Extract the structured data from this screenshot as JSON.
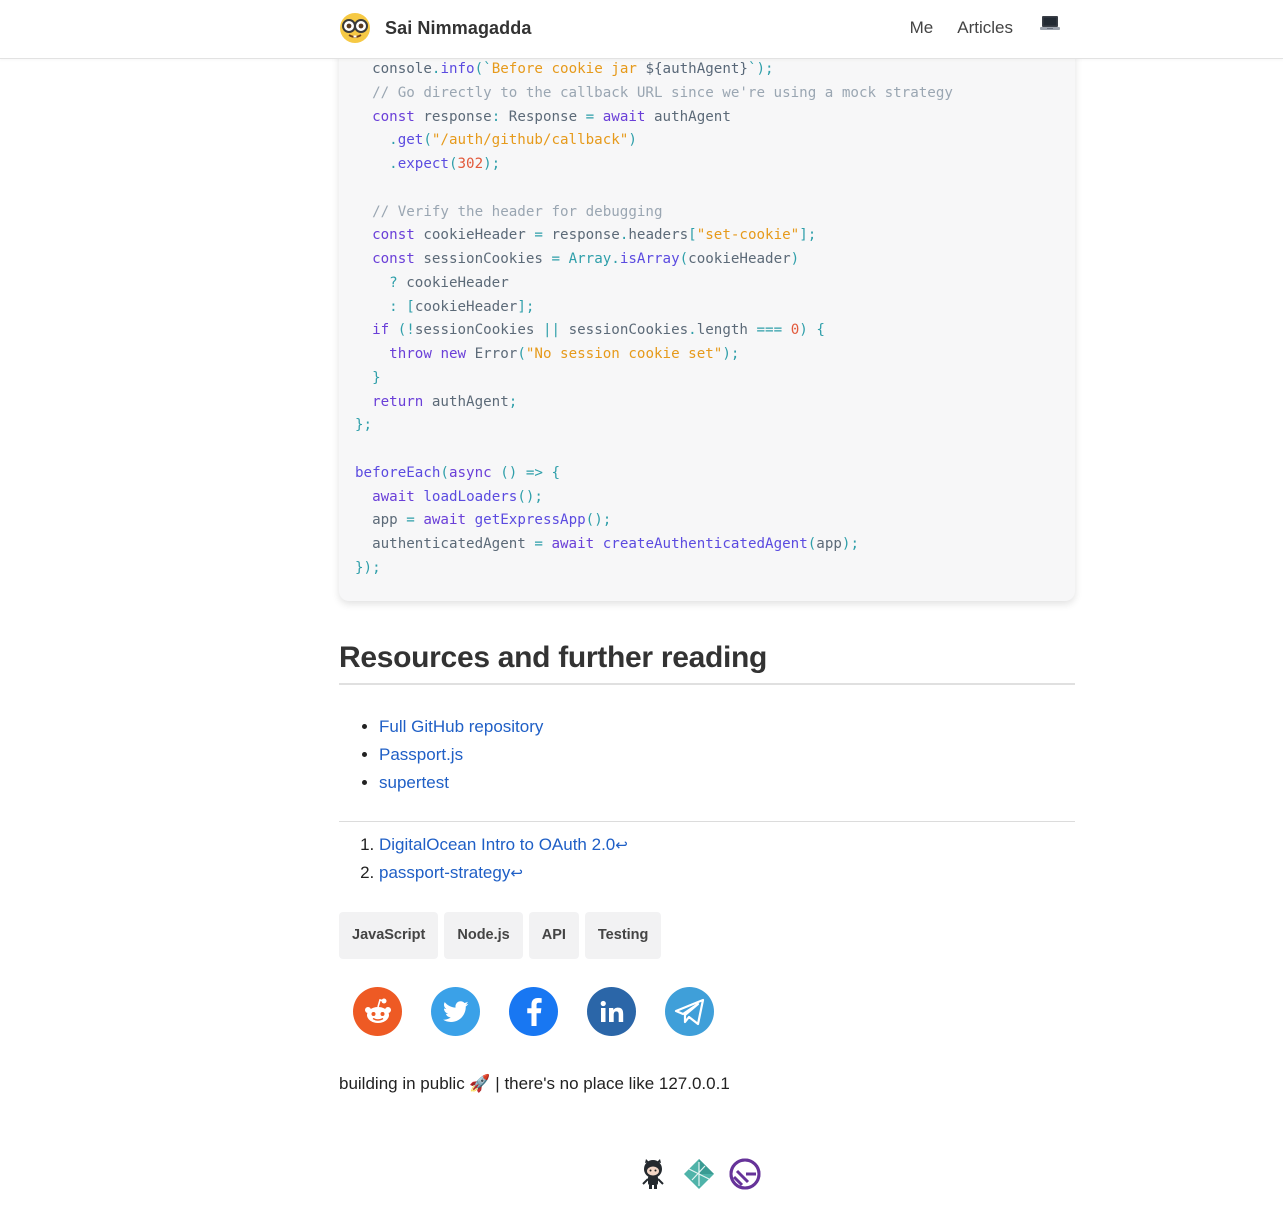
{
  "header": {
    "site_name": "Sai Nimmagadda",
    "nav": [
      {
        "label": "Me"
      },
      {
        "label": "Articles"
      }
    ],
    "avatar_icon": "nerd-face-emoji",
    "theme_icon": "laptop-icon"
  },
  "code": {
    "language": "typescript",
    "lines": [
      "  console.info(`Before cookie jar ${authAgent}`);",
      "  // Go directly to the callback URL since we're using a mock strategy",
      "  const response: Response = await authAgent",
      "    .get(\"/auth/github/callback\")",
      "    .expect(302);",
      "",
      "  // Verify the header for debugging",
      "  const cookieHeader = response.headers[\"set-cookie\"];",
      "  const sessionCookies = Array.isArray(cookieHeader)",
      "    ? cookieHeader",
      "    : [cookieHeader];",
      "  if (!sessionCookies || sessionCookies.length === 0) {",
      "    throw new Error(\"No session cookie set\");",
      "  }",
      "  return authAgent;",
      "};",
      "",
      "beforeEach(async () => {",
      "  await loadLoaders();",
      "  app = await getExpressApp();",
      "  authenticatedAgent = await createAuthenticatedAgent(app);",
      "});"
    ]
  },
  "resources": {
    "heading": "Resources and further reading",
    "links": [
      {
        "label": "Full GitHub repository"
      },
      {
        "label": "Passport.js"
      },
      {
        "label": "supertest"
      }
    ]
  },
  "footnotes": [
    {
      "label": "DigitalOcean Intro to OAuth 2.0",
      "backref": "↩"
    },
    {
      "label": "passport-strategy",
      "backref": "↩"
    }
  ],
  "tags": [
    {
      "label": "JavaScript"
    },
    {
      "label": "Node.js"
    },
    {
      "label": "API"
    },
    {
      "label": "Testing"
    }
  ],
  "share": [
    {
      "name": "reddit",
      "color": "#ee5a24"
    },
    {
      "name": "twitter",
      "color": "#3aa1e8"
    },
    {
      "name": "facebook",
      "color": "#1877f2"
    },
    {
      "name": "linkedin",
      "color": "#2b66a8"
    },
    {
      "name": "telegram",
      "color": "#3f9fd9"
    }
  ],
  "footer": {
    "tagline": "building in public 🚀 | there's no place like 127.0.0.1",
    "powered_by": [
      {
        "name": "github-octocat-icon"
      },
      {
        "name": "netlify-icon"
      },
      {
        "name": "gatsby-icon"
      }
    ]
  },
  "colors": {
    "link": "#1f5fc6",
    "code_bg": "#f7f7f8",
    "keyword": "#6a3fd8",
    "string": "#e69a1b",
    "number": "#e25a3c",
    "comment": "#9aa6b2"
  }
}
